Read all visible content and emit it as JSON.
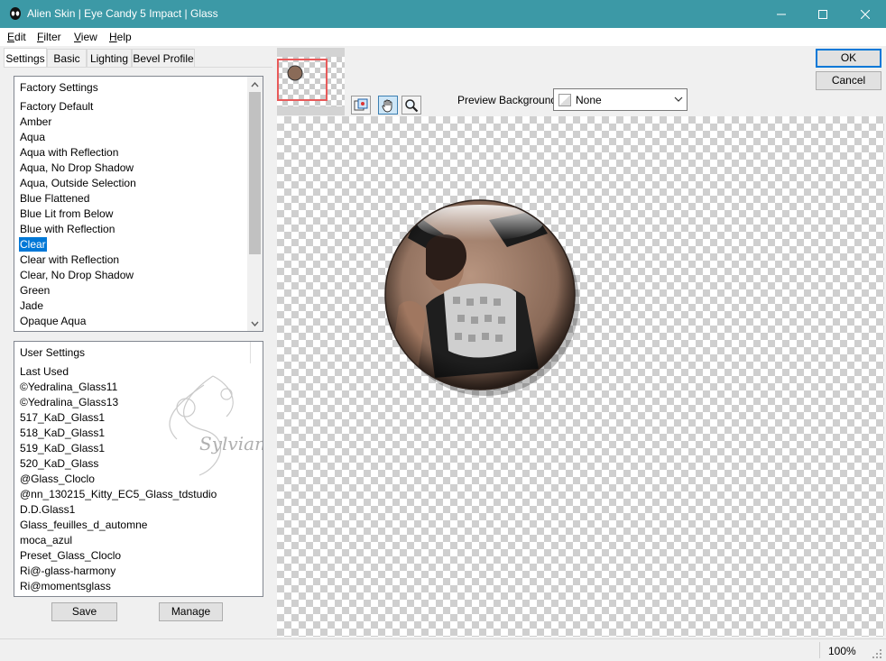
{
  "window": {
    "title": "Alien Skin | Eye Candy 5 Impact | Glass"
  },
  "menu": {
    "items": [
      {
        "label": "Edit",
        "accel": "E",
        "rest": "dit"
      },
      {
        "label": "Filter",
        "accel": "F",
        "rest": "ilter"
      },
      {
        "label": "View",
        "accel": "V",
        "rest": "iew"
      },
      {
        "label": "Help",
        "accel": "H",
        "rest": "elp"
      }
    ]
  },
  "tabs": [
    {
      "label": "Settings",
      "active": true
    },
    {
      "label": "Basic",
      "active": false
    },
    {
      "label": "Lighting",
      "active": false
    },
    {
      "label": "Bevel Profile",
      "active": false
    }
  ],
  "factory_settings": {
    "header": "Factory Settings",
    "items": [
      "Factory Default",
      "Amber",
      "Aqua",
      "Aqua with Reflection",
      "Aqua, No Drop Shadow",
      "Aqua, Outside Selection",
      "Blue Flattened",
      "Blue Lit from Below",
      "Blue with Reflection",
      "Clear",
      "Clear with Reflection",
      "Clear, No Drop Shadow",
      "Green",
      "Jade",
      "Opaque Aqua"
    ],
    "selected": "Clear"
  },
  "user_settings": {
    "header": "User Settings",
    "items": [
      "Last Used",
      "©Yedralina_Glass11",
      "©Yedralina_Glass13",
      "517_KaD_Glass1",
      "518_KaD_Glass1",
      "519_KaD_Glass1",
      "520_KaD_Glass",
      "@Glass_Cloclo",
      "@nn_130215_Kitty_EC5_Glass_tdstudio",
      "D.D.Glass1",
      "Glass_feuilles_d_automne",
      "moca_azul",
      "Preset_Glass_Cloclo",
      "Ri@-glass-harmony",
      "Ri@momentsglass"
    ]
  },
  "watermark": "Sylviane",
  "buttons": {
    "save": "Save",
    "manage": "Manage",
    "ok": "OK",
    "cancel": "Cancel"
  },
  "preview": {
    "background_label": "Preview Background:",
    "background_value": "None"
  },
  "status": {
    "zoom": "100%"
  },
  "icons": {
    "app": "alien-head-icon",
    "navigator": "navigate-preview-icon",
    "hand": "hand-pan-icon",
    "zoom": "magnifier-icon"
  },
  "colors": {
    "titlebar": "#3c99a6",
    "selection": "#0078d7",
    "default_button_border": "#0078d7",
    "thumbnail_frame": "#e85a5a"
  }
}
